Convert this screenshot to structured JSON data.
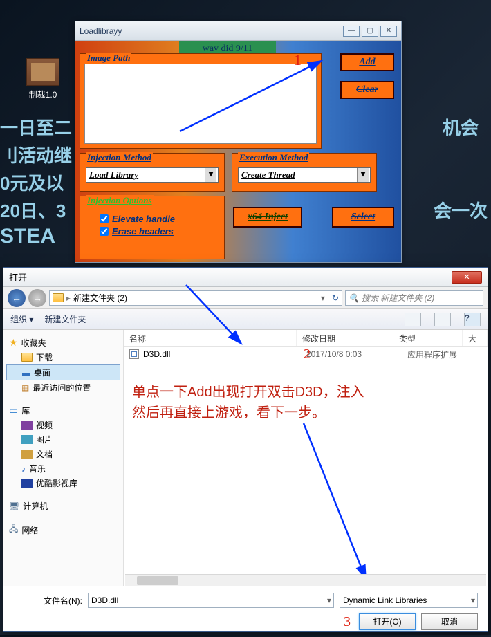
{
  "desktop": {
    "icon_label": "制裁1.0",
    "bg_lines": [
      "一日至二",
      "刂活动继",
      "0元及以",
      "20日、3",
      "STEA"
    ],
    "bg_right": [
      "机会",
      "会一次"
    ]
  },
  "injector": {
    "title": "Loadlibrayy",
    "banner": "wav did 9/11",
    "image_path_label": "Image Path",
    "add_label": "Add",
    "clear_label": "Clear",
    "inj_method_label": "Injection Method",
    "inj_method_value": "Load Library",
    "exec_method_label": "Execution Method",
    "exec_method_value": "Create Thread",
    "options_label": "Injection Options",
    "opt_elevate": "Elevate handle",
    "opt_erase": "Erase headers",
    "x64_label": "x64 Inject",
    "select_label": "Select"
  },
  "annotations": {
    "n1": "1",
    "n2": "2",
    "n3": "3",
    "instruction_line1": "单点一下Add出现打开双击D3D，注入",
    "instruction_line2": "然后再直接上游戏，看下一步。"
  },
  "dialog": {
    "title": "打开",
    "breadcrumb": "新建文件夹 (2)",
    "search_placeholder": "搜索 新建文件夹 (2)",
    "toolbar_org": "组织 ▾",
    "toolbar_newfolder": "新建文件夹",
    "sidebar": {
      "favorites": "收藏夹",
      "downloads": "下载",
      "desktop": "桌面",
      "recent": "最近访问的位置",
      "libraries": "库",
      "videos": "视频",
      "pictures": "图片",
      "documents": "文档",
      "music": "音乐",
      "youku": "优酷影视库",
      "computer": "计算机",
      "network": "网络"
    },
    "columns": {
      "name": "名称",
      "date": "修改日期",
      "type": "类型",
      "size": "大"
    },
    "file": {
      "name": "D3D.dll",
      "date": "2017/10/8 0:03",
      "type": "应用程序扩展"
    },
    "filename_label": "文件名(N):",
    "filename_value": "D3D.dll",
    "filter_value": "Dynamic Link Libraries",
    "open_btn": "打开(O)",
    "cancel_btn": "取消"
  }
}
